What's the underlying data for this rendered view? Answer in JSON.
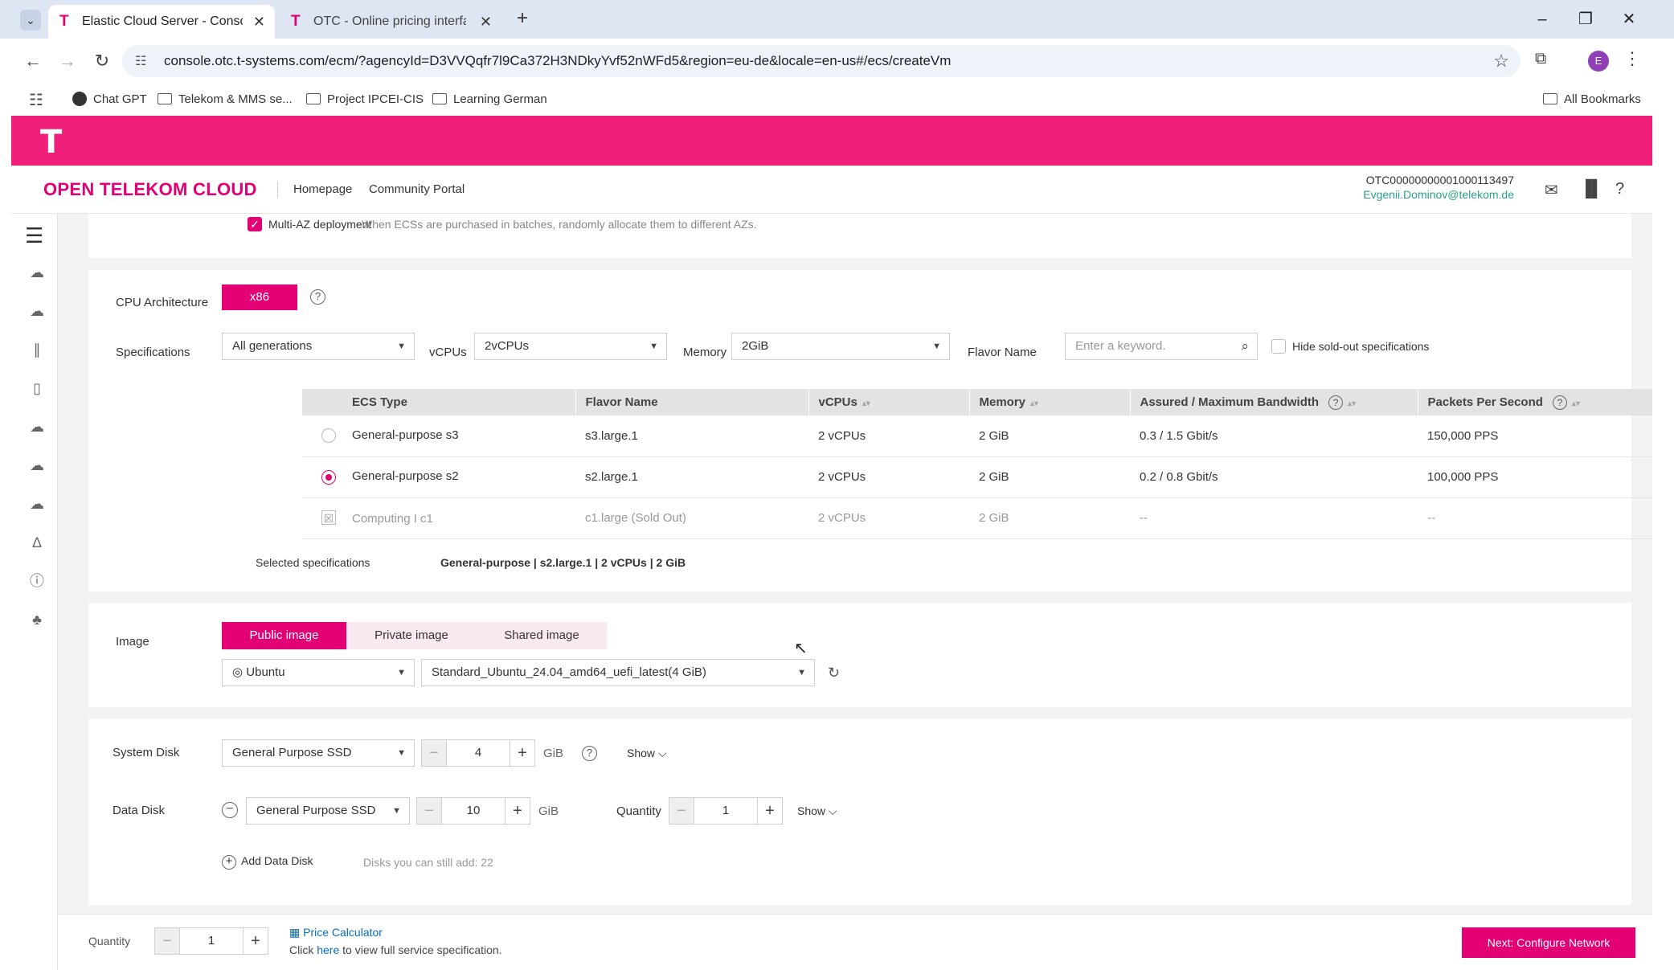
{
  "browser": {
    "tabs": [
      {
        "title": "Elastic Cloud Server - Console"
      },
      {
        "title": "OTC - Online pricing interface"
      }
    ],
    "url": "console.otc.t-systems.com/ecm/?agencyId=D3VVQqfr7l9Ca372H3NDkyYvf52nWFd5&region=eu-de&locale=en-us#/ecs/createVm",
    "profile_initial": "E",
    "bookmarks": [
      "Chat GPT",
      "Telekom & MMS se...",
      "Project IPCEI-CIS",
      "Learning German"
    ],
    "all_bookmarks": "All Bookmarks"
  },
  "header": {
    "logo": "T",
    "brand": "OPEN TELEKOM CLOUD",
    "links": [
      "Homepage",
      "Community Portal"
    ],
    "account_id": "OTC00000000001000113497",
    "account_email": "Evgenii.Dominov@telekom.de"
  },
  "multi_az": {
    "label": "Multi-AZ deployment",
    "hint": "When ECSs are purchased in batches, randomly allocate them to different AZs.",
    "checked": true
  },
  "cpu": {
    "label": "CPU Architecture",
    "value": "x86"
  },
  "specifications": {
    "label": "Specifications",
    "generation": "All generations",
    "vcpus_label": "vCPUs",
    "vcpus": "2vCPUs",
    "memory_label": "Memory",
    "memory": "2GiB",
    "flavor_label": "Flavor Name",
    "flavor_placeholder": "Enter a keyword.",
    "hide_sold_out": "Hide sold-out specifications",
    "columns": [
      "ECS Type",
      "Flavor Name",
      "vCPUs",
      "Memory",
      "Assured / Maximum Bandwidth",
      "Packets Per Second"
    ],
    "rows": [
      {
        "type": "General-purpose s3",
        "flavor": "s3.large.1",
        "vcpus": "2 vCPUs",
        "memory": "2 GiB",
        "bandwidth": "0.3 / 1.5 Gbit/s",
        "pps": "150,000 PPS"
      },
      {
        "type": "General-purpose s2",
        "flavor": "s2.large.1",
        "vcpus": "2 vCPUs",
        "memory": "2 GiB",
        "bandwidth": "0.2 / 0.8 Gbit/s",
        "pps": "100,000 PPS"
      },
      {
        "type": "Computing I c1",
        "flavor": "c1.large (Sold Out)",
        "vcpus": "2 vCPUs",
        "memory": "2 GiB",
        "bandwidth": "--",
        "pps": "--"
      }
    ],
    "selected_label": "Selected specifications",
    "selected_value": "General-purpose | s2.large.1 | 2 vCPUs | 2 GiB"
  },
  "image": {
    "label": "Image",
    "tabs": [
      "Public image",
      "Private image",
      "Shared image"
    ],
    "os": "Ubuntu",
    "version": "Standard_Ubuntu_24.04_amd64_uefi_latest(4 GiB)"
  },
  "system_disk": {
    "label": "System Disk",
    "type": "General Purpose SSD",
    "size": "4",
    "unit": "GiB",
    "show": "Show"
  },
  "data_disk": {
    "label": "Data Disk",
    "type": "General Purpose SSD",
    "size": "10",
    "unit": "GiB",
    "quantity_label": "Quantity",
    "quantity": "1",
    "show": "Show",
    "add_label": "Add Data Disk",
    "add_hint": "Disks you can still add: 22"
  },
  "footer": {
    "quantity_label": "Quantity",
    "quantity": "1",
    "price_calc": "Price Calculator",
    "click": "Click",
    "here": "here",
    "to_view": "to view full service specification.",
    "next_button": "Next: Configure Network"
  }
}
